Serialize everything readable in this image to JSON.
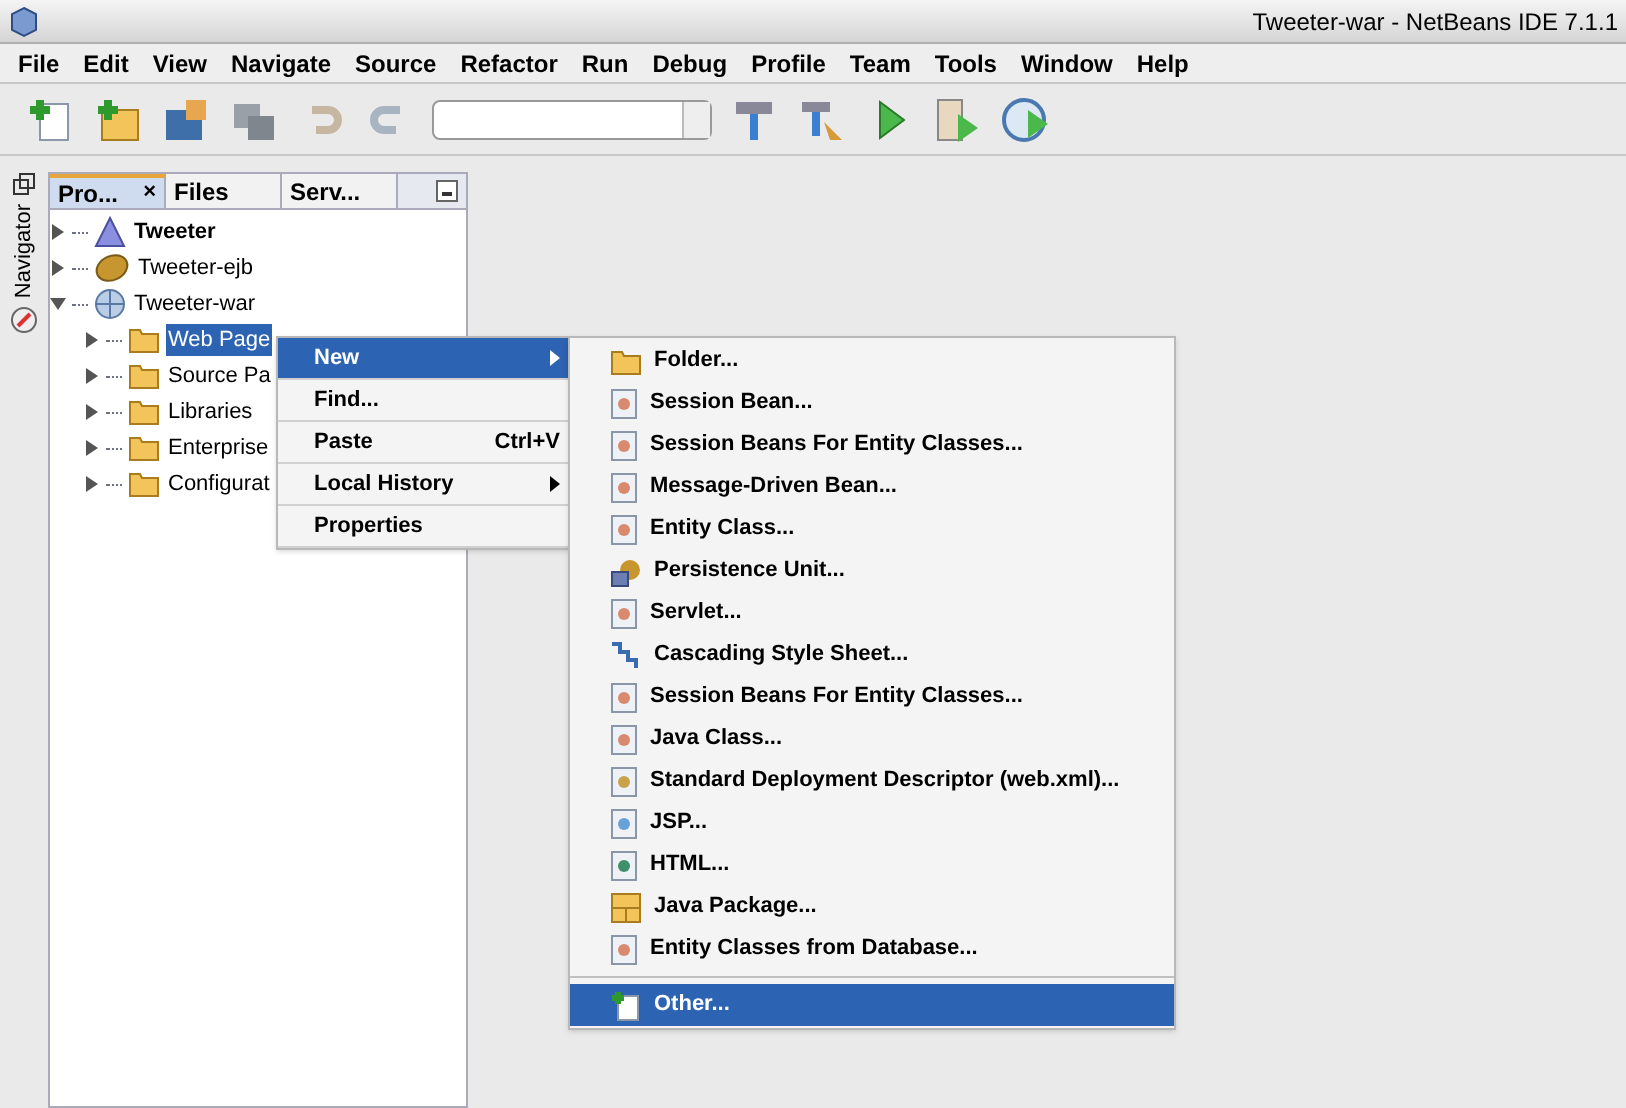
{
  "window": {
    "title": "Tweeter-war - NetBeans IDE 7.1.1"
  },
  "menu_bar": [
    "File",
    "Edit",
    "View",
    "Navigate",
    "Source",
    "Refactor",
    "Run",
    "Debug",
    "Profile",
    "Team",
    "Tools",
    "Window",
    "Help"
  ],
  "side_strip": {
    "label": "Navigator"
  },
  "tabs": [
    {
      "label": "Pro...",
      "selected": true,
      "close": "×"
    },
    {
      "label": "Files",
      "selected": false
    },
    {
      "label": "Serv...",
      "selected": false
    }
  ],
  "tree": [
    {
      "label": "Tweeter",
      "kind": "main",
      "expanded": false
    },
    {
      "label": "Tweeter-ejb",
      "kind": "ejb",
      "expanded": false
    },
    {
      "label": "Tweeter-war",
      "kind": "web",
      "expanded": true,
      "children": [
        {
          "label": "Web Page",
          "kind": "folder",
          "expanded": false,
          "selected": true
        },
        {
          "label": "Source Pa",
          "kind": "folder",
          "expanded": false,
          "selected": false
        },
        {
          "label": "Libraries",
          "kind": "folder",
          "expanded": false,
          "selected": false
        },
        {
          "label": "Enterprise",
          "kind": "folder",
          "expanded": false,
          "selected": false
        },
        {
          "label": "Configurat",
          "kind": "folder",
          "expanded": false,
          "selected": false
        }
      ]
    }
  ],
  "context_menu": [
    {
      "label": "New",
      "submenu": true,
      "selected": true
    },
    {
      "label": "Find...",
      "submenu": false,
      "selected": false
    },
    {
      "label": "Paste",
      "shortcut": "Ctrl+V",
      "submenu": false,
      "selected": false
    },
    {
      "label": "Local History",
      "submenu": true,
      "selected": false
    },
    {
      "label": "Properties",
      "submenu": false,
      "selected": false
    }
  ],
  "submenu": [
    {
      "label": "Folder...",
      "kind": "folder",
      "selected": false
    },
    {
      "label": "Session Bean...",
      "kind": "bean",
      "selected": false
    },
    {
      "label": "Session Beans For Entity Classes...",
      "kind": "bean",
      "selected": false
    },
    {
      "label": "Message-Driven Bean...",
      "kind": "bean",
      "selected": false
    },
    {
      "label": "Entity Class...",
      "kind": "bean",
      "selected": false
    },
    {
      "label": "Persistence Unit...",
      "kind": "persistence",
      "selected": false
    },
    {
      "label": "Servlet...",
      "kind": "bean",
      "selected": false
    },
    {
      "label": "Cascading Style Sheet...",
      "kind": "css",
      "selected": false
    },
    {
      "label": "Session Beans For Entity Classes...",
      "kind": "bean",
      "selected": false
    },
    {
      "label": "Java Class...",
      "kind": "bean",
      "selected": false
    },
    {
      "label": "Standard Deployment Descriptor (web.xml)...",
      "kind": "descriptor",
      "selected": false
    },
    {
      "label": "JSP...",
      "kind": "jsp",
      "selected": false
    },
    {
      "label": "HTML...",
      "kind": "html",
      "selected": false
    },
    {
      "label": "Java Package...",
      "kind": "package",
      "selected": false
    },
    {
      "label": "Entity Classes from Database...",
      "kind": "bean",
      "selected": false
    },
    {
      "label": "Other...",
      "kind": "new",
      "selected": true,
      "separator_before": true
    }
  ]
}
